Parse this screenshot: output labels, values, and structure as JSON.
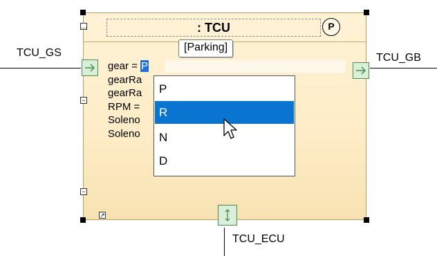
{
  "part": {
    "name": ": TCU",
    "stereotype_badge": "P",
    "state": "[Parking]"
  },
  "ports": {
    "left": "TCU_GS",
    "right": "TCU_GB",
    "bottom": "TCU_ECU"
  },
  "properties": [
    {
      "label": "gear = ",
      "value": "P"
    },
    {
      "label": "gearRa",
      "value": ""
    },
    {
      "label": "gearRa",
      "value": ""
    },
    {
      "label": "RPM = ",
      "value": ""
    },
    {
      "label": "Soleno",
      "value": ""
    },
    {
      "label": "Soleno",
      "value": ""
    }
  ],
  "dropdown": {
    "options": [
      "P",
      "R",
      "N",
      "D"
    ],
    "highlighted": "R"
  },
  "icons": {
    "collapse": "minus-box-icon",
    "expand_dots": "ellipsis-box-icon",
    "link": "link-arrow-icon",
    "port_arrow": "arrow-right-icon",
    "port_bidirectional": "arrow-up-down-icon",
    "cursor": "mouse-pointer-icon"
  },
  "colors": {
    "part_fill": "#fdecc6",
    "port_fill": "#d9efd9",
    "selection": "#0a74d1"
  }
}
